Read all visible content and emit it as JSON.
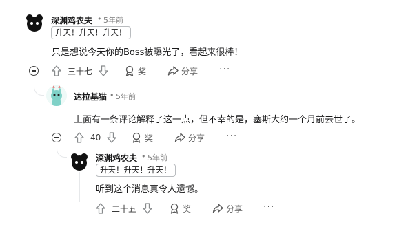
{
  "comments": [
    {
      "author": "深渊鸡农夫",
      "time": "5年前",
      "flair": "升天！升天！升天！",
      "text": "只是想说今天你的Boss被曝光了，看起来很棒！",
      "votes": "三十七",
      "award_label": "奖",
      "share_label": "分享"
    },
    {
      "author": "达拉基猫",
      "time": "5年前",
      "text": "上面有一条评论解释了这一点，但不幸的是，塞斯大约一个月前去世了。",
      "votes": "40",
      "award_label": "奖",
      "share_label": "分享"
    },
    {
      "author": "深渊鸡农夫",
      "time": "5年前",
      "flair": "升天！升天！升天！",
      "text": "听到这个消息真令人遗憾。",
      "votes": "二十五",
      "award_label": "奖",
      "share_label": "分享"
    }
  ],
  "separator": "•",
  "more_label": "···",
  "colors": {
    "upvote": "#878a8c",
    "thread_line": "#e6e8ea",
    "avatar_teal": "#7fd1c7"
  }
}
